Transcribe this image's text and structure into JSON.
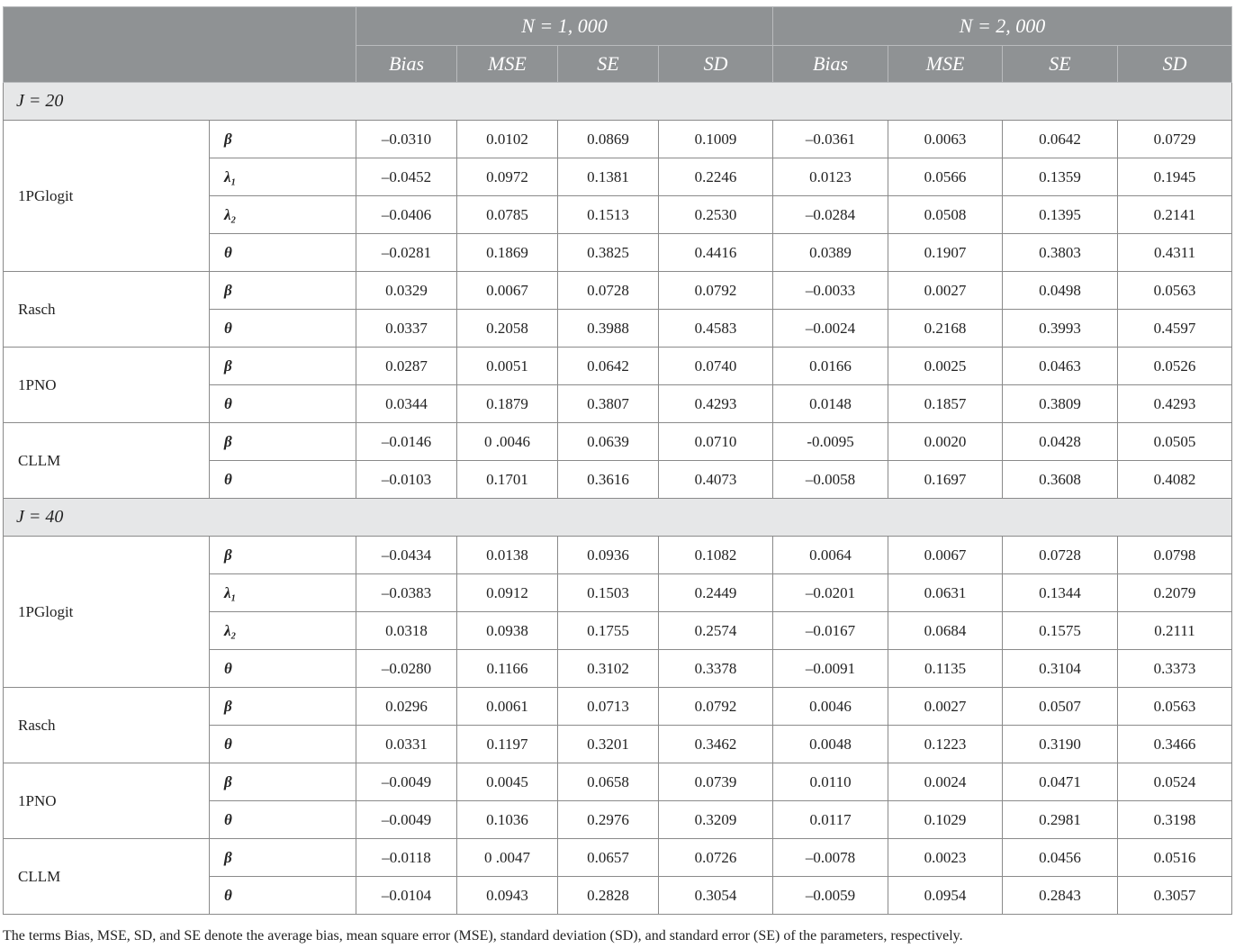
{
  "header": {
    "group_n1": "N = 1, 000",
    "group_n2": "N = 2, 000",
    "columns": [
      "Bias",
      "MSE",
      "SE",
      "SD",
      "Bias",
      "MSE",
      "SE",
      "SD"
    ]
  },
  "sections": [
    {
      "label": "J = 20",
      "models": [
        {
          "name": "1PGlogit",
          "rows": [
            {
              "param": "β",
              "values": [
                "–0.0310",
                "0.0102",
                "0.0869",
                "0.1009",
                "–0.0361",
                "0.0063",
                "0.0642",
                "0.0729"
              ]
            },
            {
              "param": "λ₁",
              "values": [
                "–0.0452",
                "0.0972",
                "0.1381",
                "0.2246",
                "0.0123",
                "0.0566",
                "0.1359",
                "0.1945"
              ]
            },
            {
              "param": "λ₂",
              "values": [
                "–0.0406",
                "0.0785",
                "0.1513",
                "0.2530",
                "–0.0284",
                "0.0508",
                "0.1395",
                "0.2141"
              ]
            },
            {
              "param": "θ",
              "values": [
                "–0.0281",
                "0.1869",
                "0.3825",
                "0.4416",
                "0.0389",
                "0.1907",
                "0.3803",
                "0.4311"
              ]
            }
          ]
        },
        {
          "name": "Rasch",
          "rows": [
            {
              "param": "β",
              "values": [
                "0.0329",
                "0.0067",
                "0.0728",
                "0.0792",
                "–0.0033",
                "0.0027",
                "0.0498",
                "0.0563"
              ]
            },
            {
              "param": "θ",
              "values": [
                "0.0337",
                "0.2058",
                "0.3988",
                "0.4583",
                "–0.0024",
                "0.2168",
                "0.3993",
                "0.4597"
              ]
            }
          ]
        },
        {
          "name": "1PNO",
          "rows": [
            {
              "param": "β",
              "values": [
                "0.0287",
                "0.0051",
                "0.0642",
                "0.0740",
                "0.0166",
                "0.0025",
                "0.0463",
                "0.0526"
              ]
            },
            {
              "param": "θ",
              "values": [
                "0.0344",
                "0.1879",
                "0.3807",
                "0.4293",
                "0.0148",
                "0.1857",
                "0.3809",
                "0.4293"
              ]
            }
          ]
        },
        {
          "name": "CLLM",
          "rows": [
            {
              "param": "β",
              "values": [
                "–0.0146",
                "0 .0046",
                "0.0639",
                "0.0710",
                "-0.0095",
                "0.0020",
                "0.0428",
                "0.0505"
              ]
            },
            {
              "param": "θ",
              "values": [
                "–0.0103",
                "0.1701",
                "0.3616",
                "0.4073",
                "–0.0058",
                "0.1697",
                "0.3608",
                "0.4082"
              ]
            }
          ]
        }
      ]
    },
    {
      "label": "J = 40",
      "models": [
        {
          "name": "1PGlogit",
          "rows": [
            {
              "param": "β",
              "values": [
                "–0.0434",
                "0.0138",
                "0.0936",
                "0.1082",
                "0.0064",
                "0.0067",
                "0.0728",
                "0.0798"
              ]
            },
            {
              "param": "λ₁",
              "values": [
                "–0.0383",
                "0.0912",
                "0.1503",
                "0.2449",
                "–0.0201",
                "0.0631",
                "0.1344",
                "0.2079"
              ]
            },
            {
              "param": "λ₂",
              "values": [
                "0.0318",
                "0.0938",
                "0.1755",
                "0.2574",
                "–0.0167",
                "0.0684",
                "0.1575",
                "0.2111"
              ]
            },
            {
              "param": "θ",
              "values": [
                "–0.0280",
                "0.1166",
                "0.3102",
                "0.3378",
                "–0.0091",
                "0.1135",
                "0.3104",
                "0.3373"
              ]
            }
          ]
        },
        {
          "name": "Rasch",
          "rows": [
            {
              "param": "β",
              "values": [
                "0.0296",
                "0.0061",
                "0.0713",
                "0.0792",
                "0.0046",
                "0.0027",
                "0.0507",
                "0.0563"
              ]
            },
            {
              "param": "θ",
              "values": [
                "0.0331",
                "0.1197",
                "0.3201",
                "0.3462",
                "0.0048",
                "0.1223",
                "0.3190",
                "0.3466"
              ]
            }
          ]
        },
        {
          "name": "1PNO",
          "rows": [
            {
              "param": "β",
              "values": [
                "–0.0049",
                "0.0045",
                "0.0658",
                "0.0739",
                "0.0110",
                "0.0024",
                "0.0471",
                "0.0524"
              ]
            },
            {
              "param": "θ",
              "values": [
                "–0.0049",
                "0.1036",
                "0.2976",
                "0.3209",
                "0.0117",
                "0.1029",
                "0.2981",
                "0.3198"
              ]
            }
          ]
        },
        {
          "name": "CLLM",
          "rows": [
            {
              "param": "β",
              "values": [
                "–0.0118",
                "0 .0047",
                "0.0657",
                "0.0726",
                "–0.0078",
                "0.0023",
                "0.0456",
                "0.0516"
              ]
            },
            {
              "param": "θ",
              "values": [
                "–0.0104",
                "0.0943",
                "0.2828",
                "0.3054",
                "–0.0059",
                "0.0954",
                "0.2843",
                "0.3057"
              ]
            }
          ]
        }
      ]
    }
  ],
  "footnote": "The terms Bias, MSE, SD, and SE denote the average bias, mean square error (MSE), standard deviation (SD), and standard error (SE) of the parameters, respectively."
}
